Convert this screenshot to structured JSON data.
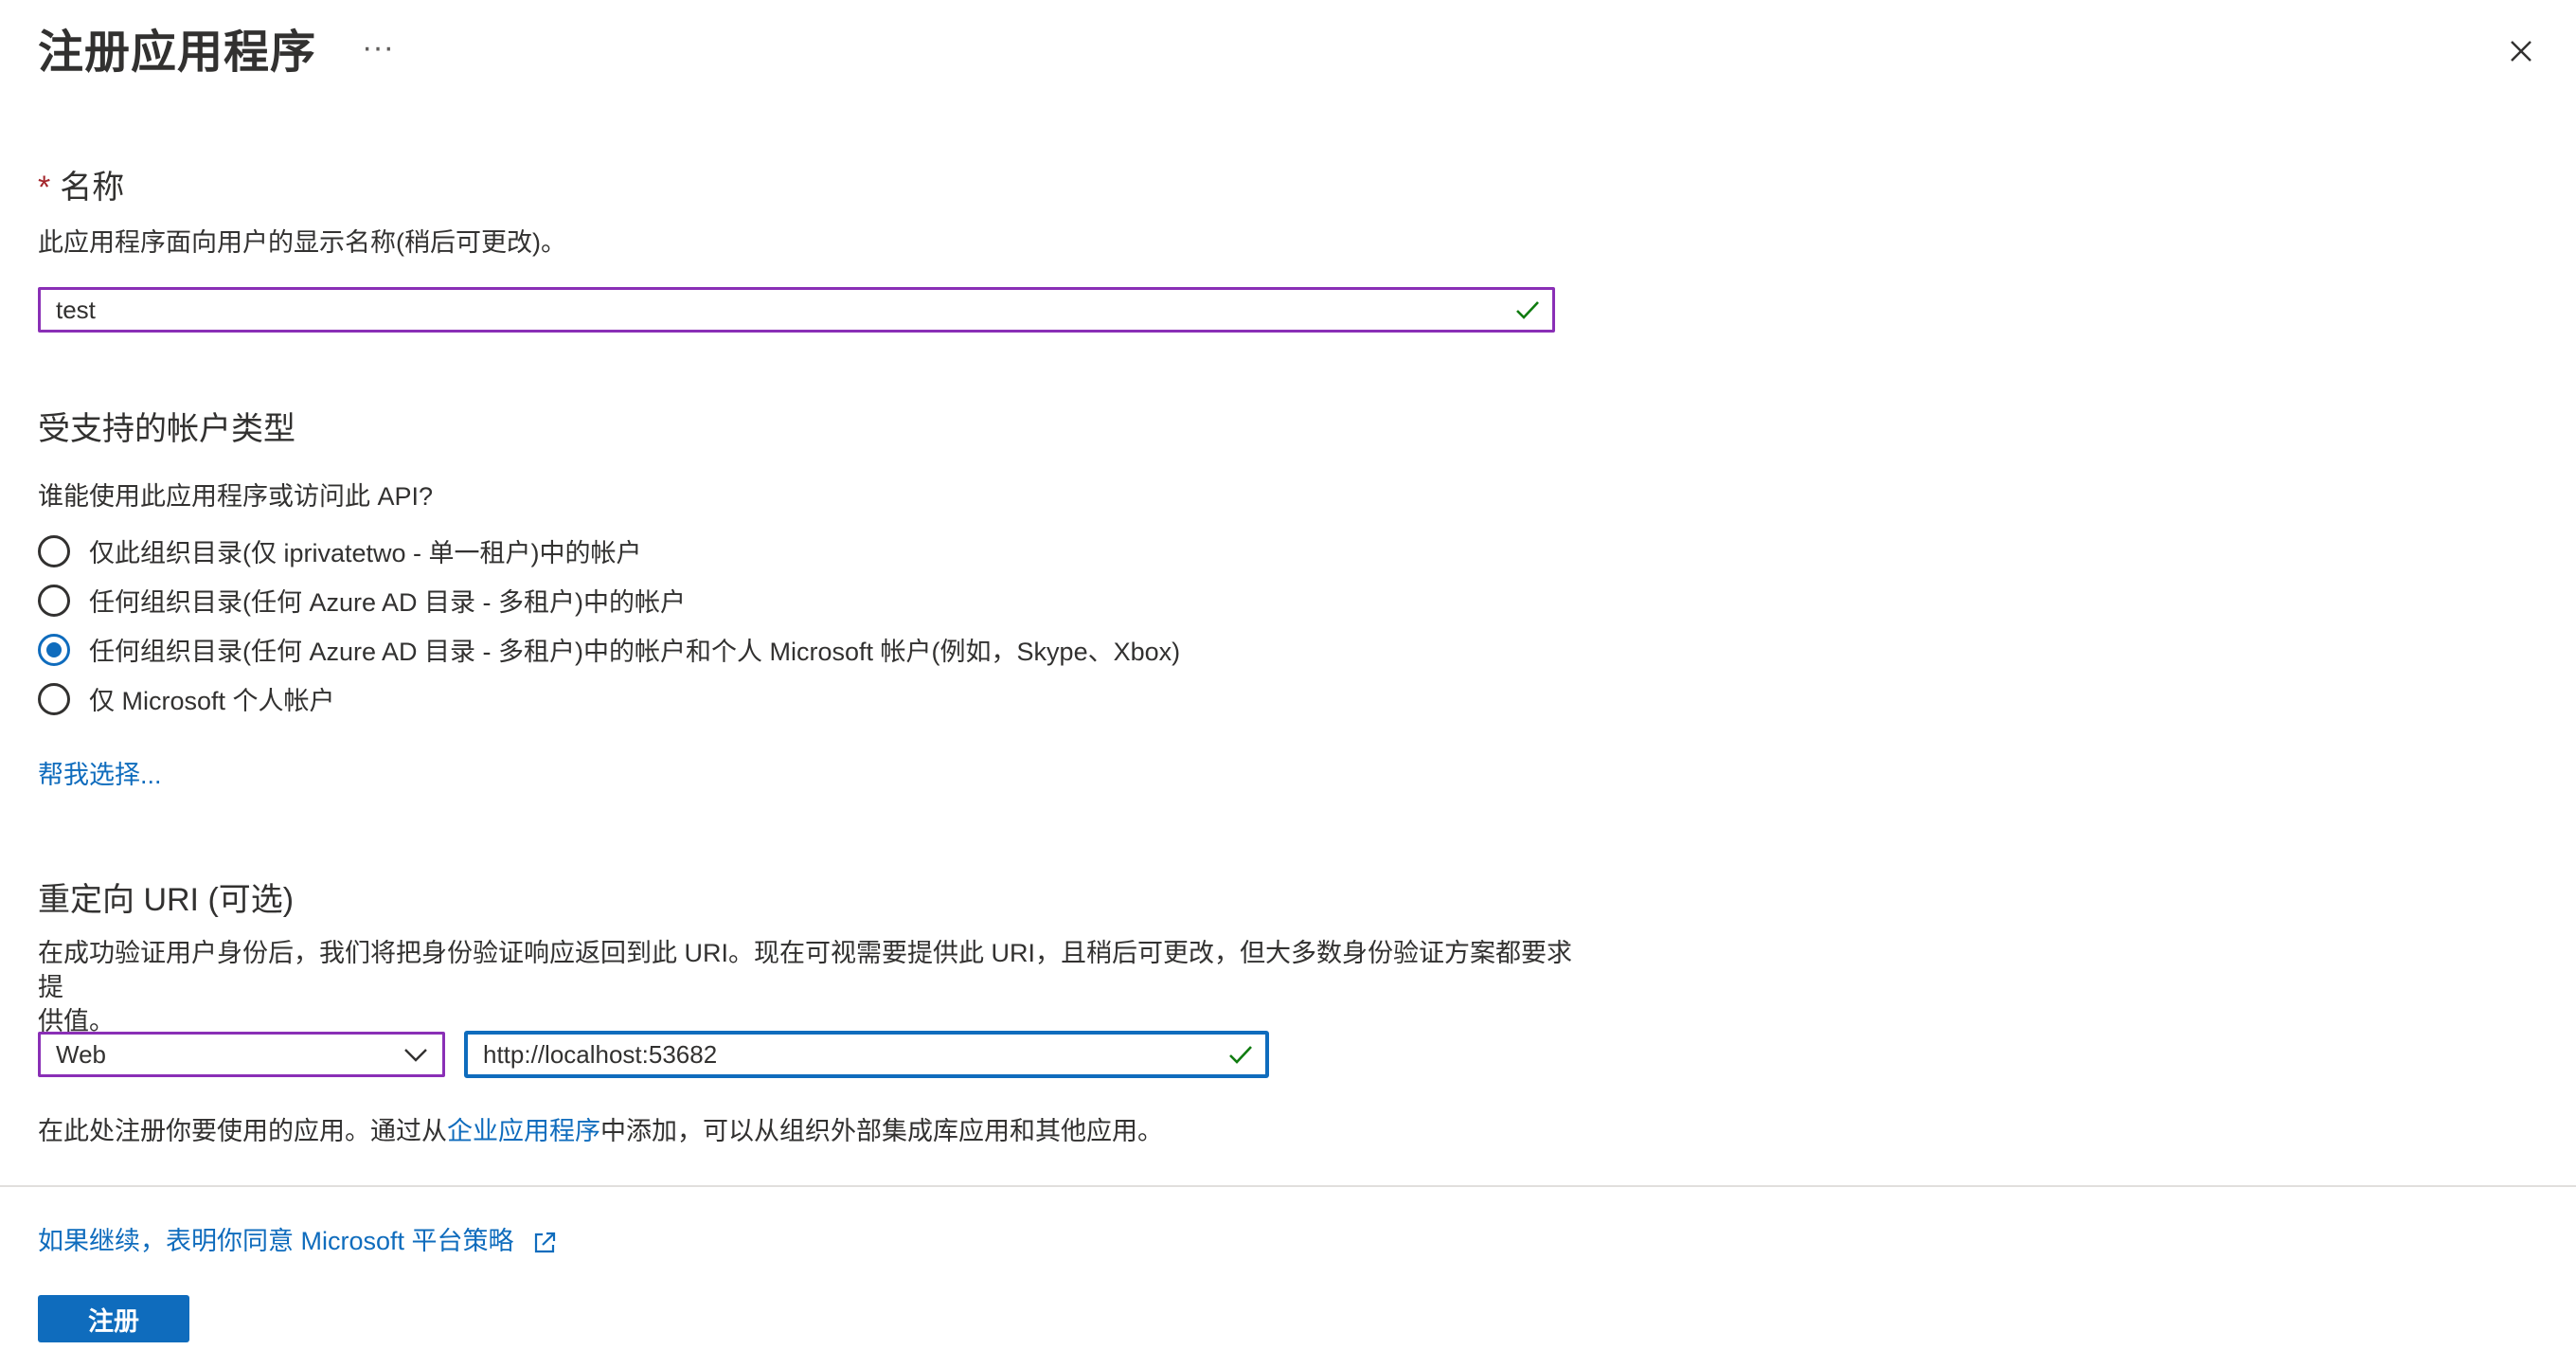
{
  "header": {
    "title": "注册应用程序",
    "more_label": "···"
  },
  "name_section": {
    "required_mark": "*",
    "label": "名称",
    "description": "此应用程序面向用户的显示名称(稍后可更改)。",
    "input_value": "test"
  },
  "account_types": {
    "heading": "受支持的帐户类型",
    "question": "谁能使用此应用程序或访问此 API?",
    "options": [
      {
        "label": "仅此组织目录(仅 iprivatetwo - 单一租户)中的帐户",
        "checked": false
      },
      {
        "label": "任何组织目录(任何 Azure AD 目录 - 多租户)中的帐户",
        "checked": false
      },
      {
        "label": "任何组织目录(任何 Azure AD 目录 - 多租户)中的帐户和个人 Microsoft 帐户(例如，Skype、Xbox)",
        "checked": true
      },
      {
        "label": "仅 Microsoft 个人帐户",
        "checked": false
      }
    ],
    "help_link": "帮我选择..."
  },
  "redirect": {
    "heading": "重定向 URI (可选)",
    "description_line1": "在成功验证用户身份后，我们将把身份验证响应返回到此 URI。现在可视需要提供此 URI，且稍后可更改，但大多数身份验证方案都要求提",
    "description_line2": "供值。",
    "platform_value": "Web",
    "uri_value": "http://localhost:53682",
    "note_prefix": "在此处注册你要使用的应用。通过从",
    "note_link": "企业应用程序",
    "note_suffix": "中添加，可以从组织外部集成库应用和其他应用。"
  },
  "footer": {
    "policy_link": "如果继续，表明你同意 Microsoft 平台策略",
    "register_button": "注册"
  },
  "colors": {
    "accent": "#0f6cbd",
    "valid_border": "#8a2fb6",
    "check_green": "#107c10",
    "required": "#a4262c"
  }
}
